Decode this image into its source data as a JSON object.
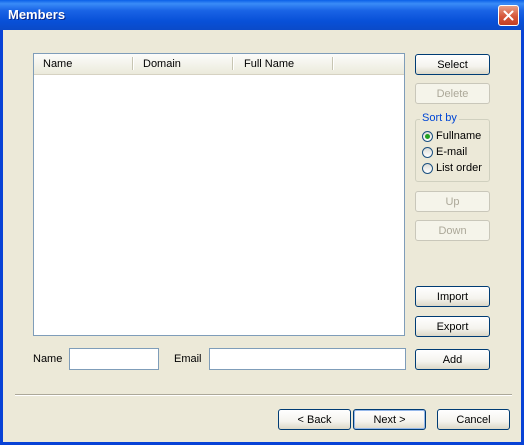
{
  "window": {
    "title": "Members"
  },
  "list": {
    "columns": [
      "Name",
      "Domain",
      "Full Name"
    ]
  },
  "buttons": {
    "select": "Select",
    "delete": "Delete",
    "up": "Up",
    "down": "Down",
    "import": "Import",
    "export": "Export",
    "add": "Add",
    "back": "< Back",
    "next": "Next >",
    "cancel": "Cancel"
  },
  "sort_by": {
    "title": "Sort by",
    "options": [
      "Fullname",
      "E-mail",
      "List order"
    ],
    "selected": "Fullname"
  },
  "form": {
    "name_label": "Name",
    "name_value": "",
    "email_label": "Email",
    "email_value": ""
  }
}
